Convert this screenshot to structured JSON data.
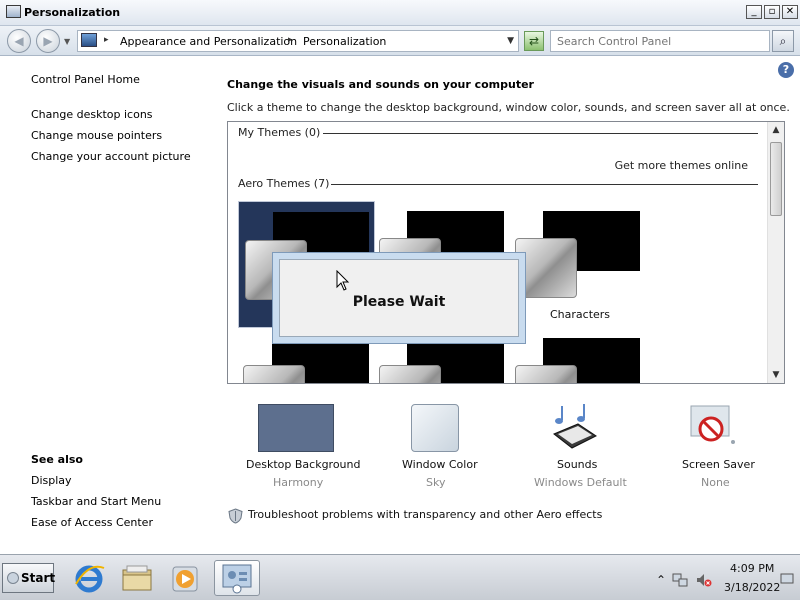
{
  "window": {
    "title": "Personalization",
    "controls": [
      "_",
      "▫",
      "✕"
    ]
  },
  "navigation": {
    "back_label": "◀",
    "forward_label": "▶",
    "breadcrumb": [
      "Appearance and Personalization",
      "Personalization"
    ],
    "search_placeholder": "Search Control Panel"
  },
  "left_panel": {
    "top_links": [
      "Control Panel Home",
      "Change desktop icons",
      "Change mouse pointers",
      "Change your account picture"
    ],
    "see_also_title": "See also",
    "see_also_links": [
      "Display",
      "Taskbar and Start Menu",
      "Ease of Access Center"
    ]
  },
  "main": {
    "heading": "Change the visuals and sounds on your computer",
    "subheading": "Click a theme to change the desktop background, window color, sounds, and screen saver all at once.",
    "groups": {
      "my_themes": "My Themes (0)",
      "get_more": "Get more themes online",
      "aero_themes": "Aero Themes (7)"
    },
    "theme_labels": {
      "third": "Characters"
    },
    "help_icon": "?"
  },
  "dialog": {
    "message": "Please Wait"
  },
  "settings": [
    {
      "name": "Desktop Background",
      "value": "Harmony",
      "icon": "desktop-background-swatch",
      "color": "#5d6f8e"
    },
    {
      "name": "Window Color",
      "value": "Sky",
      "icon": "window-color-swatch",
      "color": "#dde6ef"
    },
    {
      "name": "Sounds",
      "value": "Windows Default",
      "icon": "music-notes-icon"
    },
    {
      "name": "Screen Saver",
      "value": "None",
      "icon": "screensaver-none-icon"
    }
  ],
  "troubleshoot_link": "Troubleshoot problems with transparency and other Aero effects",
  "taskbar": {
    "start_label": "Start",
    "clock_time": "4:09 PM",
    "clock_date": "3/18/2022",
    "tray_expand": "⌃"
  },
  "colors": {
    "selected_theme": "#24365a",
    "titlebar": "#dfe6ef",
    "link_text": "#000000"
  }
}
